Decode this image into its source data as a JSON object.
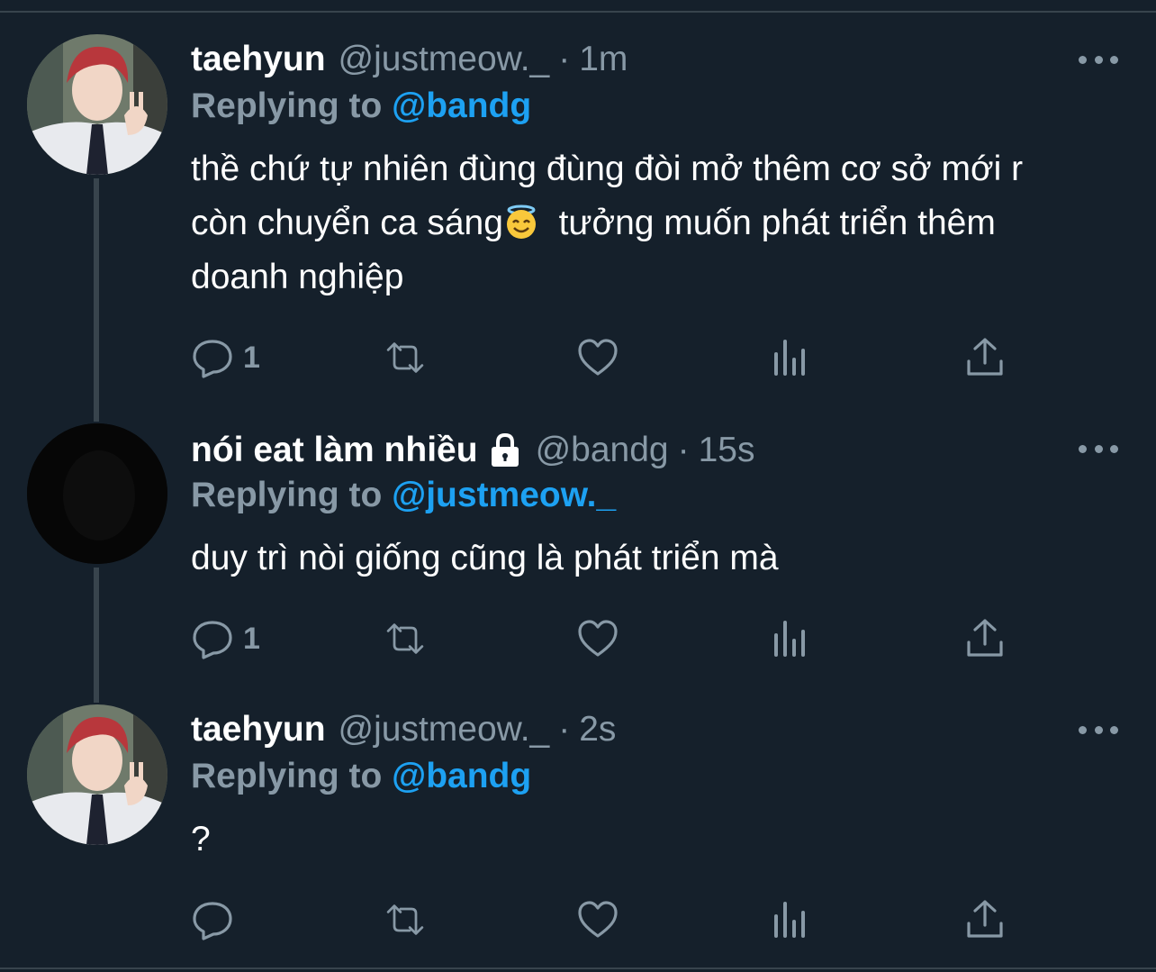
{
  "tweets": [
    {
      "name": "taehyun",
      "handle": "@justmeow._",
      "dot": "·",
      "time": "1m",
      "replying_prefix": "Replying to ",
      "replying_to": "@bandg",
      "body_part1": "thề chứ tự nhiên đùng đùng đòi mở thêm cơ sở mới r còn chuyển ca sáng",
      "body_part2": "  tưởng muốn phát triển thêm doanh nghiệp",
      "emoji": "smiling-face-with-halo-icon",
      "reply_count": "1"
    },
    {
      "name": "nói eat làm nhiều",
      "handle": "@bandg",
      "dot": "·",
      "time": "15s",
      "replying_prefix": "Replying to ",
      "replying_to": "@justmeow._",
      "body": "duy trì nòi giống cũng là phát triển mà",
      "reply_count": "1"
    },
    {
      "name": "taehyun",
      "handle": "@justmeow._",
      "dot": "·",
      "time": "2s",
      "replying_prefix": "Replying to ",
      "replying_to": "@bandg",
      "body": "?",
      "reply_count": ""
    }
  ],
  "colors": {
    "background": "#15202b",
    "text": "#ffffff",
    "secondary": "#8899a6",
    "link": "#1da1f2",
    "border": "#38444d"
  }
}
